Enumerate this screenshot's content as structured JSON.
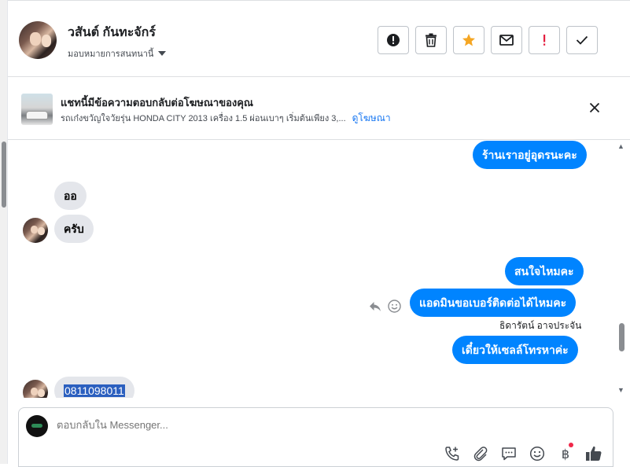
{
  "header": {
    "contact_name": "วสันต์ กันทะจักร์",
    "assign_label": "มอบหมายการสนทนานี้",
    "actions": [
      {
        "icon": "alert-circle-icon",
        "color": "#1c1e21"
      },
      {
        "icon": "trash-icon",
        "color": "#1c1e21"
      },
      {
        "icon": "star-icon",
        "color": "#f5a623"
      },
      {
        "icon": "envelope-icon",
        "color": "#1c1e21"
      },
      {
        "icon": "exclamation-icon",
        "color": "#e41e3f"
      },
      {
        "icon": "check-icon",
        "color": "#1c1e21"
      }
    ]
  },
  "ad": {
    "title": "แชทนี้มีข้อความตอบกลับต่อโฆษณาของคุณ",
    "description": "รถเก๋งขวัญใจวัยรุ่น HONDA CITY 2013 เครื่อง 1.5 ผ่อนเบาๆ เริ่มต้นเพียง 3,...",
    "link": "ดูโฆษณา"
  },
  "messages": [
    {
      "side": "out",
      "text": "ร้านเราอยู่อุดรนะคะ"
    },
    {
      "side": "in",
      "text": "ออ"
    },
    {
      "side": "in",
      "text": "ครับ"
    },
    {
      "side": "out",
      "text": "สนใจไหมคะ"
    },
    {
      "side": "out",
      "text": "แอดมินขอเบอร์ติดต่อได้ไหมคะ"
    },
    {
      "side": "out",
      "text": "เดี๋ยวให้เซลล์โทรหาค่ะ",
      "sender": "ธิดารัตน์ อาจประจัน"
    },
    {
      "side": "in",
      "text": "0811098011"
    }
  ],
  "composer": {
    "placeholder": "ตอบกลับใน Messenger...",
    "currency_symbol": "฿"
  },
  "colors": {
    "outgoing_bubble": "#0084ff",
    "incoming_bubble": "#e4e6eb",
    "link": "#1877f2"
  }
}
